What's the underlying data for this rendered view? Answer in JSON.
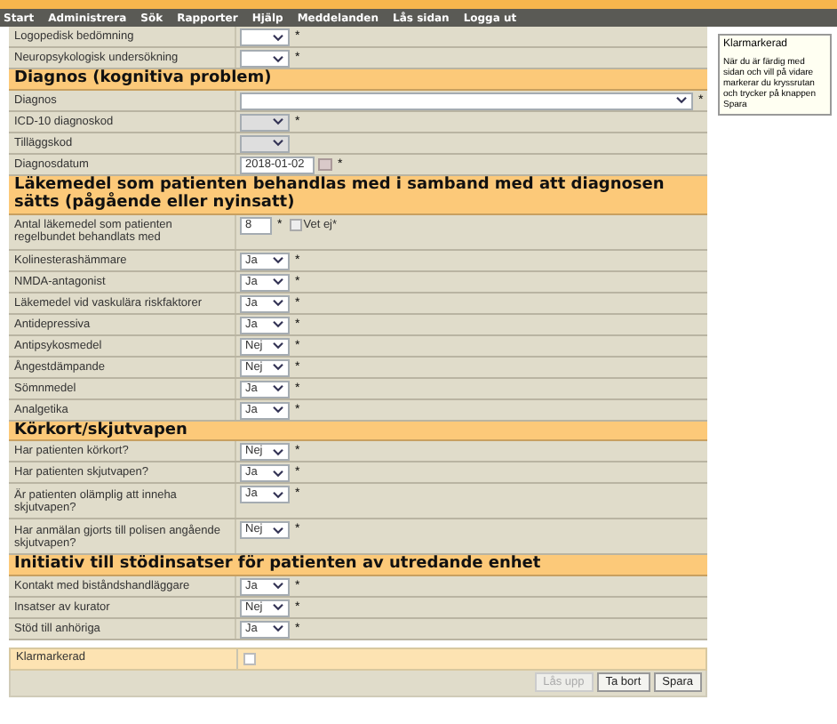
{
  "nav": [
    "Start",
    "Administrera",
    "Sök",
    "Rapporter",
    "Hjälp",
    "Meddelanden",
    "Lås sidan",
    "Logga ut"
  ],
  "sections": [
    {
      "rows": [
        {
          "label": "Logopedisk bedömning",
          "kind": "select",
          "value": "",
          "mark": "*"
        },
        {
          "label": "Neuropsykologisk undersökning",
          "kind": "select",
          "value": "",
          "mark": "*"
        }
      ]
    },
    {
      "title": "Diagnos (kognitiva problem)",
      "rows": [
        {
          "label": "Diagnos",
          "kind": "wide_select",
          "value": "",
          "mark": "*"
        },
        {
          "label": "ICD-10 diagnoskod",
          "kind": "select",
          "value": "",
          "mark": "*",
          "disabled": true
        },
        {
          "label": "Tilläggskod",
          "kind": "select",
          "value": "",
          "disabled": true
        },
        {
          "label": "Diagnosdatum",
          "kind": "date",
          "value": "2018-01-02",
          "mark": "*"
        }
      ]
    },
    {
      "title": "Läkemedel som patienten behandlas med i samband med att diagnosen sätts (pågående eller nyinsatt)",
      "rows": [
        {
          "label": "Antal läkemedel som patienten regelbundet behandlats med",
          "kind": "number",
          "value": "8",
          "mark": "*",
          "check_label": "Vet ej*",
          "checked": false
        },
        {
          "label": "Kolinesterashämmare",
          "kind": "select",
          "value": "Ja",
          "mark": "*"
        },
        {
          "label": "NMDA-antagonist",
          "kind": "select",
          "value": "Ja",
          "mark": "*"
        },
        {
          "label": "Läkemedel vid vaskulära riskfaktorer",
          "kind": "select",
          "value": "Ja",
          "mark": "*"
        },
        {
          "label": "Antidepressiva",
          "kind": "select",
          "value": "Ja",
          "mark": "*"
        },
        {
          "label": "Antipsykosmedel",
          "kind": "select",
          "value": "Nej",
          "mark": "*"
        },
        {
          "label": "Ångestdämpande",
          "kind": "select",
          "value": "Nej",
          "mark": "*"
        },
        {
          "label": "Sömnmedel",
          "kind": "select",
          "value": "Ja",
          "mark": "*"
        },
        {
          "label": "Analgetika",
          "kind": "select",
          "value": "Ja",
          "mark": "*"
        }
      ]
    },
    {
      "title": "Körkort/skjutvapen",
      "rows": [
        {
          "label": "Har patienten körkort?",
          "kind": "select",
          "value": "Nej",
          "mark": "*"
        },
        {
          "label": "Har patienten skjutvapen?",
          "kind": "select",
          "value": "Ja",
          "mark": "*"
        },
        {
          "label": "Är patienten olämplig att inneha skjutvapen?",
          "kind": "select",
          "value": "Ja",
          "mark": "*"
        },
        {
          "label": "Har anmälan gjorts till polisen angående skjutvapen?",
          "kind": "select",
          "value": "Nej",
          "mark": "*"
        }
      ]
    },
    {
      "title": "Initiativ till stödinsatser för patienten av utredande enhet",
      "rows": [
        {
          "label": "Kontakt med biståndshandläggare",
          "kind": "select",
          "value": "Ja",
          "mark": "*"
        },
        {
          "label": "Insatser av kurator",
          "kind": "select",
          "value": "Nej",
          "mark": "*"
        },
        {
          "label": "Stöd till anhöriga",
          "kind": "select",
          "value": "Ja",
          "mark": "*"
        }
      ]
    }
  ],
  "ready": {
    "label": "Klarmarkerad",
    "checked": false
  },
  "buttons": [
    {
      "label": "Lås upp",
      "disabled": true
    },
    {
      "label": "Ta bort",
      "disabled": false
    },
    {
      "label": "Spara",
      "disabled": false
    }
  ],
  "help": {
    "title": "Klarmarkerad",
    "text": "När du är färdig med sidan och vill på vidare markerar du kryssrutan och trycker på knappen Spara"
  }
}
